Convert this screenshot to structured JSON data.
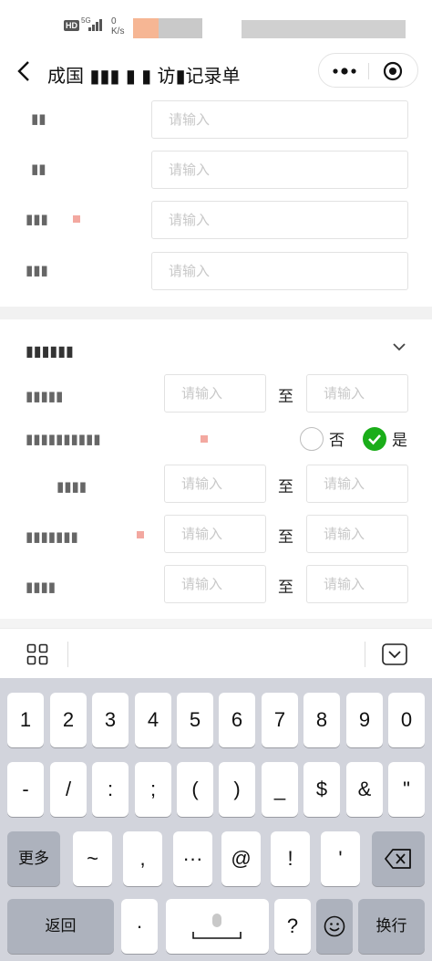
{
  "status_bar": {
    "hd": "HD",
    "network": "5G",
    "speed_value": "0",
    "speed_unit": "K/s"
  },
  "nav": {
    "title": "成国 ▮▮▮ ▮ ▮ 访▮记录单",
    "more_icon": "more-dots-icon",
    "close_icon": "target-close-icon"
  },
  "section1": {
    "rows": [
      {
        "label": "▮▮",
        "placeholder": "请输入"
      },
      {
        "label": "▮▮",
        "placeholder": "请输入"
      },
      {
        "label": "▮▮▮",
        "placeholder": "请输入"
      },
      {
        "label": "▮▮▮",
        "placeholder": "请输入"
      }
    ]
  },
  "section2": {
    "title": "▮▮▮▮▮▮",
    "range_rows": [
      {
        "label": "▮▮▮▮▮",
        "from_placeholder": "请输入",
        "sep": "至",
        "to_placeholder": "请输入"
      },
      {
        "label": "▮▮▮▮",
        "from_placeholder": "请输入",
        "sep": "至",
        "to_placeholder": "请输入"
      },
      {
        "label": "▮▮▮▮▮▮▮",
        "from_placeholder": "请输入",
        "sep": "至",
        "to_placeholder": "请输入"
      },
      {
        "label": "▮▮▮▮",
        "from_placeholder": "请输入",
        "sep": "至",
        "to_placeholder": "请输入"
      }
    ],
    "toggle_row": {
      "label": "▮▮▮▮▮▮▮▮▮▮",
      "option_no": "否",
      "option_yes": "是",
      "selected": "是"
    }
  },
  "keyboard": {
    "row1": [
      "1",
      "2",
      "3",
      "4",
      "5",
      "6",
      "7",
      "8",
      "9",
      "0"
    ],
    "row2": [
      "-",
      "/",
      ":",
      ";",
      "(",
      ")",
      "_",
      "$",
      "&",
      "\""
    ],
    "row3_left": "更多",
    "row3": [
      "~",
      ",",
      "···",
      "@",
      "!",
      "'"
    ],
    "row4_left": "返回",
    "row4_dot": "·",
    "row4_question": "?",
    "row4_right": "换行",
    "toolbar_left_icon": "grid-icon",
    "toolbar_right_icon": "keyboard-hide-icon",
    "delete_icon": "backspace-icon",
    "mic_icon": "microphone-icon",
    "emoji_icon": "emoji-icon"
  },
  "colors": {
    "accent_green": "#1aad19",
    "required_mark": "#f3a8a0",
    "keyboard_bg": "#d2d4dc"
  }
}
